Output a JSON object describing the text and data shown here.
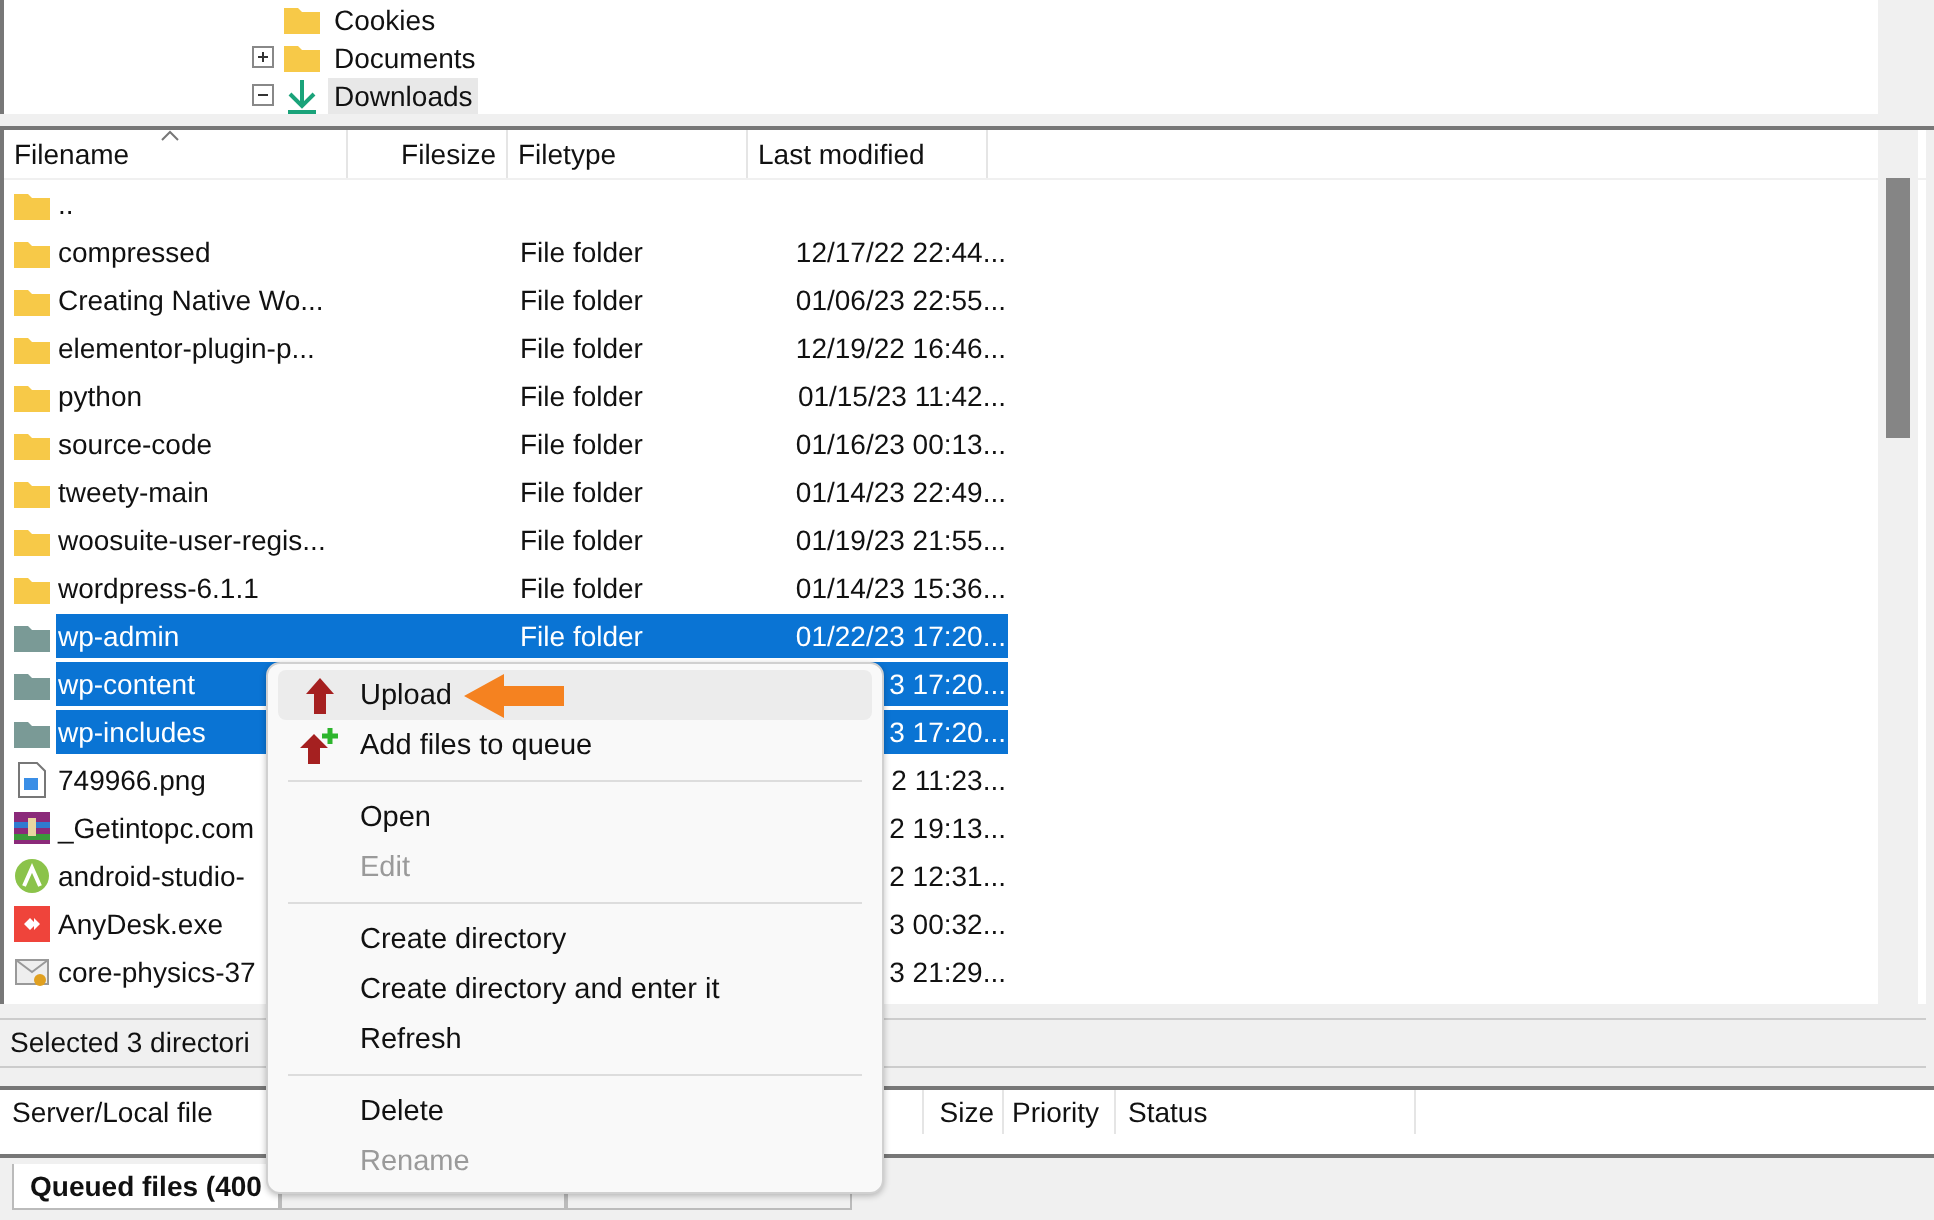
{
  "tree": [
    {
      "label": "Cookies",
      "kind": "folder",
      "selected": false
    },
    {
      "label": "Documents",
      "kind": "folder",
      "expanded": false,
      "selected": false
    },
    {
      "label": "Downloads",
      "kind": "download",
      "expanded": true,
      "selected": true
    }
  ],
  "file_list": {
    "columns": [
      {
        "label": "Filename",
        "sorted": true
      },
      {
        "label": "Filesize",
        "sorted": false
      },
      {
        "label": "Filetype",
        "sorted": false
      },
      {
        "label": "Last modified",
        "sorted": false
      }
    ],
    "rows": [
      {
        "name": "..",
        "kind": "folder",
        "type": "",
        "modified": "",
        "selected": false
      },
      {
        "name": "compressed",
        "kind": "folder",
        "type": "File folder",
        "modified": "12/17/22 22:44...",
        "selected": false
      },
      {
        "name": "Creating Native Wo...",
        "kind": "folder",
        "type": "File folder",
        "modified": "01/06/23 22:55...",
        "selected": false
      },
      {
        "name": "elementor-plugin-p...",
        "kind": "folder",
        "type": "File folder",
        "modified": "12/19/22 16:46...",
        "selected": false
      },
      {
        "name": "python",
        "kind": "folder",
        "type": "File folder",
        "modified": "01/15/23 11:42...",
        "selected": false
      },
      {
        "name": "source-code",
        "kind": "folder",
        "type": "File folder",
        "modified": "01/16/23 00:13...",
        "selected": false
      },
      {
        "name": "tweety-main",
        "kind": "folder",
        "type": "File folder",
        "modified": "01/14/23 22:49...",
        "selected": false
      },
      {
        "name": "woosuite-user-regis...",
        "kind": "folder",
        "type": "File folder",
        "modified": "01/19/23 21:55...",
        "selected": false
      },
      {
        "name": "wordpress-6.1.1",
        "kind": "folder",
        "type": "File folder",
        "modified": "01/14/23 15:36...",
        "selected": false
      },
      {
        "name": "wp-admin",
        "kind": "folder",
        "type": "File folder",
        "modified": "01/22/23 17:20...",
        "selected": true
      },
      {
        "name": "wp-content",
        "kind": "folder",
        "type": "",
        "modified": "3 17:20...",
        "selected": true
      },
      {
        "name": "wp-includes",
        "kind": "folder",
        "type": "",
        "modified": "3 17:20...",
        "selected": true
      },
      {
        "name": "749966.png",
        "kind": "image",
        "type": "",
        "modified": "2 11:23...",
        "selected": false
      },
      {
        "name": "_Getintopc.com",
        "kind": "archive",
        "type": "",
        "modified": "2 19:13...",
        "selected": false
      },
      {
        "name": "android-studio-",
        "kind": "android",
        "type": "",
        "modified": "2 12:31...",
        "selected": false
      },
      {
        "name": "AnyDesk.exe",
        "kind": "app",
        "type": "",
        "modified": "3 00:32...",
        "selected": false
      },
      {
        "name": "core-physics-37",
        "kind": "installer",
        "type": "",
        "modified": "3 21:29...",
        "selected": false
      }
    ]
  },
  "status_bar": "Selected 3 directori",
  "queue": {
    "columns": [
      "Server/Local file",
      "Size",
      "Priority",
      "Status"
    ],
    "tabs": [
      {
        "label": "Queued files (400",
        "selected": true
      },
      {
        "selected": false
      },
      {
        "selected": false
      }
    ]
  },
  "context_menu": [
    {
      "label": "Upload",
      "kind": "upload",
      "disabled": false,
      "highlighted": true
    },
    {
      "label": "Add files to queue",
      "kind": "queue",
      "disabled": false,
      "highlighted": false
    },
    {
      "kind": "separator"
    },
    {
      "label": "Open",
      "kind": "plain",
      "disabled": false,
      "highlighted": false
    },
    {
      "label": "Edit",
      "kind": "plain",
      "disabled": true,
      "highlighted": false
    },
    {
      "kind": "separator"
    },
    {
      "label": "Create directory",
      "kind": "plain",
      "disabled": false,
      "highlighted": false
    },
    {
      "label": "Create directory and enter it",
      "kind": "plain",
      "disabled": false,
      "highlighted": false
    },
    {
      "label": "Refresh",
      "kind": "plain",
      "disabled": false,
      "highlighted": false
    },
    {
      "kind": "separator"
    },
    {
      "label": "Delete",
      "kind": "plain",
      "disabled": false,
      "highlighted": false
    },
    {
      "label": "Rename",
      "kind": "plain",
      "disabled": true,
      "highlighted": false
    }
  ]
}
